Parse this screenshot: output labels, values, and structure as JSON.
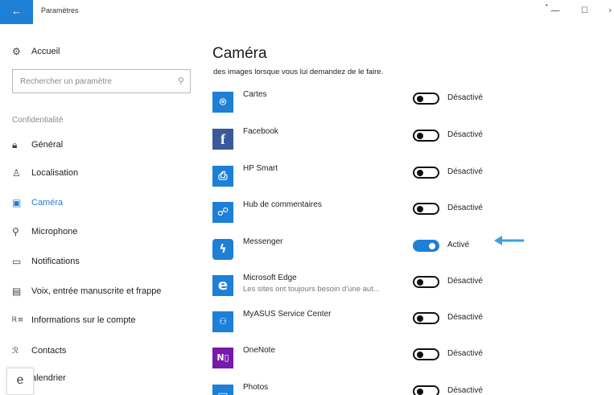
{
  "titlebar": {
    "back_glyph": "←",
    "title": "Paramètres",
    "minimize_glyph": "—",
    "maximize_glyph": "☐",
    "close_glyph": "›",
    "dot_glyph": "•"
  },
  "sidebar": {
    "home": {
      "label": "Accueil",
      "icon": "gear-icon"
    },
    "search": {
      "placeholder": "Rechercher un paramètre"
    },
    "section": "Confidentialité",
    "items": [
      {
        "label": "Général",
        "icon": "lock-icon"
      },
      {
        "label": "Localisation",
        "icon": "person-pin-icon"
      },
      {
        "label": "Caméra",
        "icon": "camera-icon",
        "active": true
      },
      {
        "label": "Microphone",
        "icon": "microphone-icon"
      },
      {
        "label": "Notifications",
        "icon": "chat-icon"
      },
      {
        "label": "Voix, entrée manuscrite et frappe",
        "icon": "clipboard-icon"
      },
      {
        "label": "Informations sur le compte",
        "icon": "account-info-icon"
      },
      {
        "label": "Contacts",
        "icon": "contacts-icon"
      },
      {
        "label": "alendrier",
        "icon": "calendar-icon"
      }
    ],
    "taskbar_glyph": "e"
  },
  "main": {
    "title": "Caméra",
    "description": "des images lorsque vous lui demandez de le faire.",
    "apps": [
      {
        "name": "Cartes",
        "state": "Désactivé",
        "on": false,
        "color": "#1e7fd6",
        "icon": "maps-icon"
      },
      {
        "name": "Facebook",
        "state": "Désactivé",
        "on": false,
        "color": "#3b5998",
        "icon": "facebook-icon"
      },
      {
        "name": "HP Smart",
        "state": "Désactivé",
        "on": false,
        "color": "#1e7fd6",
        "icon": "printer-icon"
      },
      {
        "name": "Hub de commentaires",
        "state": "Désactivé",
        "on": false,
        "color": "#1e7fd6",
        "icon": "feedback-icon"
      },
      {
        "name": "Messenger",
        "state": "Activé",
        "on": true,
        "color": "#1e7fd6",
        "icon": "messenger-icon"
      },
      {
        "name": "Microsoft Edge",
        "subtitle": "Les sites ont toujours besoin d'une aut...",
        "state": "Désactivé",
        "on": false,
        "color": "#1e7fd6",
        "icon": "edge-icon"
      },
      {
        "name": "MyASUS Service Center",
        "state": "Désactivé",
        "on": false,
        "color": "#1e7fd6",
        "icon": "myasus-icon"
      },
      {
        "name": "OneNote",
        "state": "Désactivé",
        "on": false,
        "color": "#7719aa",
        "icon": "onenote-icon"
      },
      {
        "name": "Photos",
        "state": "Désactivé",
        "on": false,
        "color": "#1e7fd6",
        "icon": "photos-icon"
      }
    ]
  },
  "colors": {
    "accent": "#1e7fd6",
    "arrow": "#3aa0e0"
  }
}
